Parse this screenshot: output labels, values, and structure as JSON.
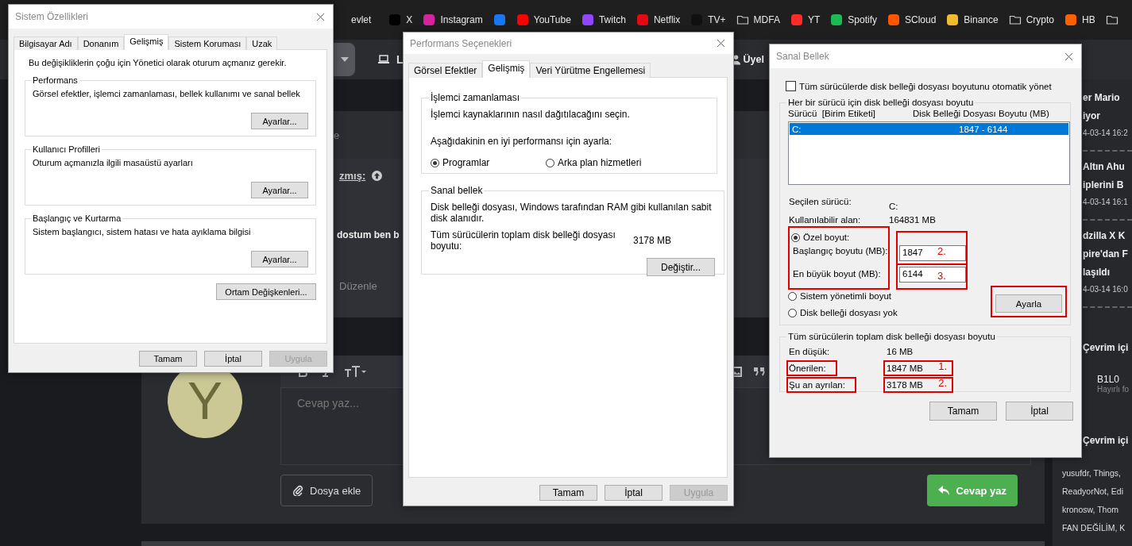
{
  "browser": {
    "bookmarks": [
      {
        "label": "evlet",
        "kind": "text"
      },
      {
        "label": "X",
        "kind": "site",
        "color": "#000000"
      },
      {
        "label": "Instagram",
        "kind": "site",
        "color": "#d6249f"
      },
      {
        "kind": "site",
        "color": "#1877f2"
      },
      {
        "label": "YouTube",
        "kind": "site",
        "color": "#ff0000"
      },
      {
        "label": "Twitch",
        "kind": "site",
        "color": "#9146ff"
      },
      {
        "label": "Netflix",
        "kind": "site",
        "color": "#e50914"
      },
      {
        "label": "TV+",
        "kind": "site",
        "color": "#111111"
      },
      {
        "label": "MDFA",
        "kind": "folder"
      },
      {
        "label": "YT",
        "kind": "site",
        "color": "#ff2a2a"
      },
      {
        "label": "Spotify",
        "kind": "site",
        "color": "#1db954"
      },
      {
        "label": "SCloud",
        "kind": "site",
        "color": "#ff5500"
      },
      {
        "label": "Binance",
        "kind": "site",
        "color": "#f3ba2f"
      },
      {
        "label": "Crypto",
        "kind": "folder"
      },
      {
        "label": "HB",
        "kind": "site",
        "color": "#ff6000"
      },
      {
        "kind": "folder"
      }
    ],
    "nav": {
      "link": "L",
      "user": "Üyel"
    }
  },
  "forum": {
    "header_fragment": "e",
    "post": {
      "author_fragment": "zmış:",
      "text": "dostum ben b",
      "edit_link": "Düzenle"
    },
    "reply": {
      "avatar_letter": "Y",
      "placeholder": "Cevap yaz...",
      "attach_button": "Dosya ekle",
      "submit_button": "Cevap yaz"
    }
  },
  "sidebar": {
    "news": [
      {
        "lines": [
          "er Mario",
          "iyor"
        ],
        "time": "4-03-14 16:2"
      },
      {
        "lines": [
          "Altın Ahu",
          "iplerini B"
        ],
        "time": "4-03-14 16:1"
      },
      {
        "lines": [
          "dzilla X K",
          "pire'dan F",
          "laşıldı"
        ],
        "time": "4-03-14 16:0"
      }
    ],
    "staff": {
      "title": "Çevrim içi",
      "members": [
        {
          "name": "B1L0",
          "status": "Hayırlı fo"
        }
      ]
    },
    "members": {
      "title": "Çevrim içi",
      "lines": [
        "yusufdr, Things,",
        "ReadyorNot, Edi",
        "kronosw, Thom",
        "FAN DEĞİLİM, K"
      ]
    }
  },
  "system_properties": {
    "title": "Sistem Özellikleri",
    "tabs": [
      {
        "label": "Bilgisayar Adı",
        "selected": false
      },
      {
        "label": "Donanım",
        "selected": false
      },
      {
        "label": "Gelişmiş",
        "selected": true
      },
      {
        "label": "Sistem Koruması",
        "selected": false
      },
      {
        "label": "Uzak",
        "selected": false
      }
    ],
    "notice": "Bu değişikliklerin çoğu için Yönetici olarak oturum açmanız gerekir.",
    "groups": [
      {
        "title": "Performans",
        "description": "Görsel efektler, işlemci zamanlaması, bellek kullanımı ve sanal bellek",
        "button": "Ayarlar..."
      },
      {
        "title": "Kullanıcı Profilleri",
        "description": "Oturum açmanızla ilgili masaüstü ayarları",
        "button": "Ayarlar..."
      },
      {
        "title": "Başlangıç ve Kurtarma",
        "description": "Sistem başlangıcı, sistem hatası ve hata ayıklama bilgisi",
        "button": "Ayarlar..."
      }
    ],
    "env_button": "Ortam Değişkenleri...",
    "buttons": [
      {
        "label": "Tamam",
        "disabled": false
      },
      {
        "label": "İptal",
        "disabled": false
      },
      {
        "label": "Uygula",
        "disabled": true
      }
    ]
  },
  "performance_options": {
    "title": "Performans Seçenekleri",
    "tabs": [
      {
        "label": "Görsel Efektler",
        "selected": false
      },
      {
        "label": "Gelişmiş",
        "selected": true
      },
      {
        "label": "Veri Yürütme Engellemesi",
        "selected": false
      }
    ],
    "scheduling": {
      "title": "İşlemci zamanlaması",
      "description": "İşlemci kaynaklarının nasıl dağıtılacağını seçin.",
      "prompt": "Aşağıdakinin en iyi performansı için ayarla:",
      "options": [
        {
          "label": "Programlar",
          "selected": true
        },
        {
          "label": "Arka plan hizmetleri",
          "selected": false
        }
      ]
    },
    "virtual_memory": {
      "title": "Sanal bellek",
      "description": "Disk belleği dosyası, Windows tarafından RAM gibi kullanılan sabit disk alanıdır.",
      "total_label": "Tüm sürücülerin toplam disk belleği dosyası boyutu:",
      "total_value": "3178 MB",
      "button": "Değiştir..."
    },
    "buttons": [
      {
        "label": "Tamam",
        "disabled": false
      },
      {
        "label": "İptal",
        "disabled": false
      },
      {
        "label": "Uygula",
        "disabled": true
      }
    ]
  },
  "virtual_memory": {
    "title": "Sanal Bellek",
    "auto_manage": {
      "label": "Tüm sürücülerde disk belleği dosyası boyutunu otomatik yönet",
      "checked": false
    },
    "per_drive": {
      "title": "Her bir sürücü için disk belleği dosyası boyutu",
      "columns": [
        "Sürücü  [Birim Etiketi]",
        "Disk Belleği Dosyası Boyutu (MB)"
      ],
      "drives": [
        {
          "drive": "C:",
          "size": "1847 - 6144",
          "selected": true
        }
      ],
      "selected_drive": {
        "label": "Seçilen sürücü:",
        "value": "C:"
      },
      "free_space": {
        "label": "Kullanılabilir alan:",
        "value": "164831 MB"
      },
      "custom_size": {
        "label": "Özel boyut:",
        "selected": true,
        "highlighted": true
      },
      "fields": [
        {
          "label": "Başlangıç boyutu (MB):",
          "value": "1847",
          "highlighted": true,
          "annotation": "2."
        },
        {
          "label": "En büyük boyut (MB):",
          "value": "6144",
          "highlighted": true,
          "annotation": "3."
        }
      ],
      "other_options": [
        {
          "label": "Sistem yönetimli boyut",
          "selected": false
        },
        {
          "label": "Disk belleği dosyası yok",
          "selected": false
        }
      ],
      "set_button": {
        "label": "Ayarla",
        "highlighted": true
      }
    },
    "totals": {
      "title": "Tüm sürücülerin toplam disk belleği dosyası boyutu",
      "rows": [
        {
          "label": "En düşük:",
          "value": "16 MB",
          "highlighted": false
        },
        {
          "label": "Önerilen:",
          "value": "1847 MB",
          "highlighted": true,
          "annotation": "1."
        },
        {
          "label": "Şu an ayrılan:",
          "value": "3178 MB",
          "highlighted": true,
          "annotation": "2."
        }
      ]
    },
    "buttons": [
      {
        "label": "Tamam",
        "disabled": false
      },
      {
        "label": "İptal",
        "disabled": false
      }
    ]
  }
}
